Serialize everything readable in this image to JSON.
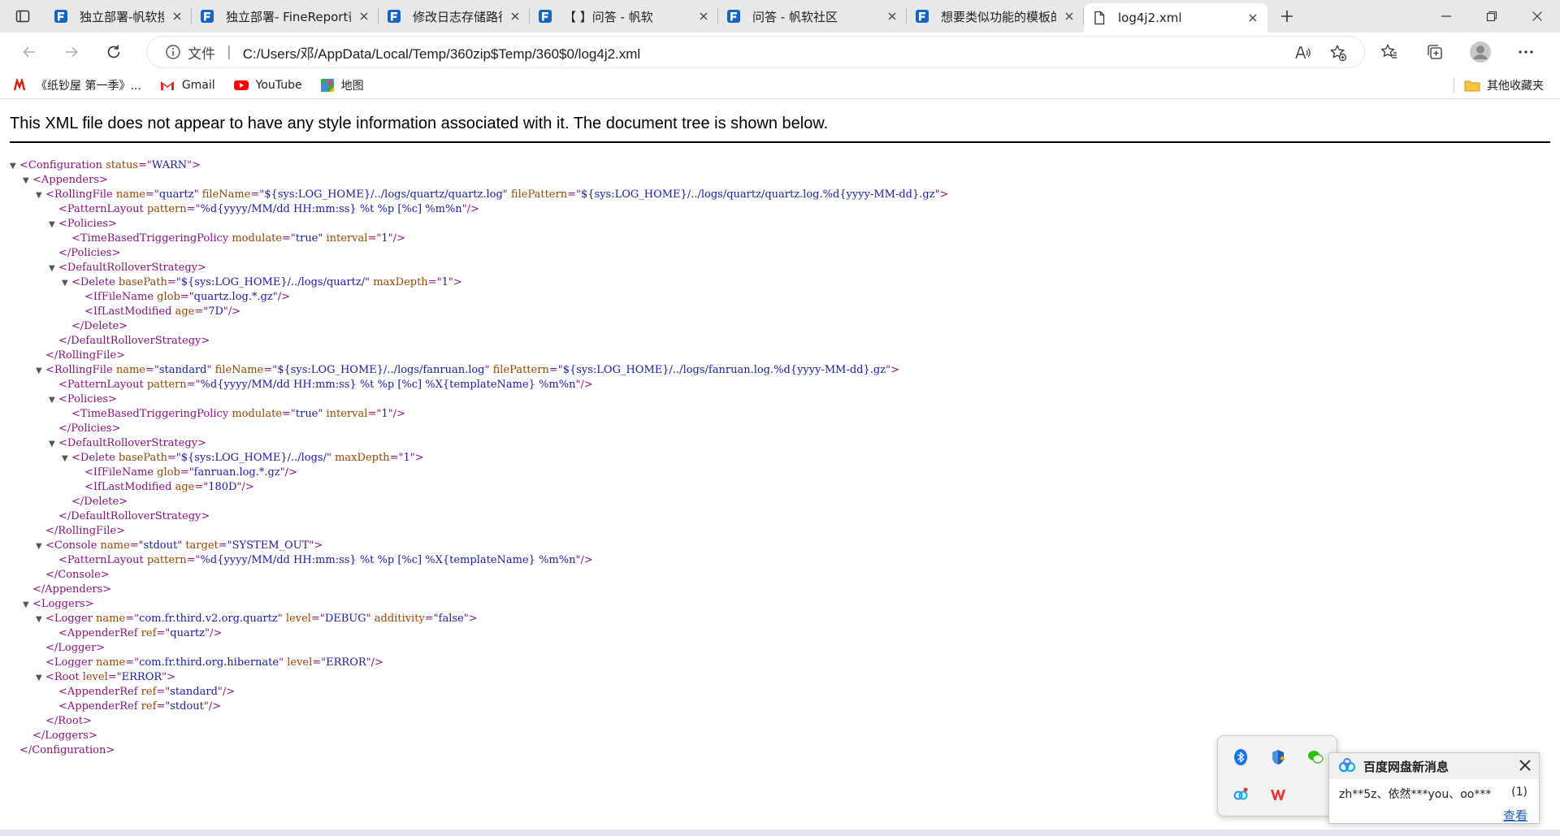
{
  "browser": {
    "tabs": [
      {
        "title": "独立部署-帆软搜索",
        "active": false
      },
      {
        "title": "独立部署- FineReport帮",
        "active": false
      },
      {
        "title": "修改日志存储路径-帆软",
        "active": false
      },
      {
        "title": "【                】问答 - 帆软",
        "active": false
      },
      {
        "title": "问答 - 帆软社区",
        "active": false
      },
      {
        "title": "想要类似功能的模板的",
        "active": false
      },
      {
        "title": "log4j2.xml",
        "active": true
      }
    ],
    "address": {
      "scheme_label": "文件",
      "separator": "|",
      "url": "C:/Users/邓/AppData/Local/Temp/360zip$Temp/360$0/log4j2.xml"
    },
    "bookmarks": [
      {
        "label": "《纸钞屋 第一季》...",
        "icon": "maoyan-icon"
      },
      {
        "label": "Gmail",
        "icon": "gmail-icon"
      },
      {
        "label": "YouTube",
        "icon": "youtube-icon"
      },
      {
        "label": "地图",
        "icon": "maps-icon"
      }
    ],
    "other_bookmarks": "其他收藏夹"
  },
  "xml_viewer": {
    "header": "This XML file does not appear to have any style information associated with it. The document tree is shown below.",
    "lines": [
      {
        "indent": 0,
        "toggle": true,
        "parts": [
          [
            "tg",
            "<Configuration "
          ],
          [
            "an",
            "status"
          ],
          [
            "tg",
            "=\""
          ],
          [
            "av",
            "WARN"
          ],
          [
            "tg",
            "\">"
          ]
        ]
      },
      {
        "indent": 1,
        "toggle": true,
        "parts": [
          [
            "tg",
            "<Appenders>"
          ]
        ]
      },
      {
        "indent": 2,
        "toggle": true,
        "parts": [
          [
            "tg",
            "<RollingFile "
          ],
          [
            "an",
            "name"
          ],
          [
            "tg",
            "=\""
          ],
          [
            "av",
            "quartz"
          ],
          [
            "tg",
            "\" "
          ],
          [
            "an",
            "fileName"
          ],
          [
            "tg",
            "=\""
          ],
          [
            "av",
            "${sys:LOG_HOME}/../logs/quartz/quartz.log"
          ],
          [
            "tg",
            "\" "
          ],
          [
            "an",
            "filePattern"
          ],
          [
            "tg",
            "=\""
          ],
          [
            "av",
            "${sys:LOG_HOME}/../logs/quartz/quartz.log.%d{yyyy-MM-dd}.gz"
          ],
          [
            "tg",
            "\">"
          ]
        ]
      },
      {
        "indent": 3,
        "toggle": false,
        "parts": [
          [
            "tg",
            "<PatternLayout "
          ],
          [
            "an",
            "pattern"
          ],
          [
            "tg",
            "=\""
          ],
          [
            "av",
            "%d{yyyy/MM/dd HH:mm:ss} %t %p [%c] %m%n"
          ],
          [
            "tg",
            "\"/>"
          ]
        ]
      },
      {
        "indent": 3,
        "toggle": true,
        "parts": [
          [
            "tg",
            "<Policies>"
          ]
        ]
      },
      {
        "indent": 4,
        "toggle": false,
        "parts": [
          [
            "tg",
            "<TimeBasedTriggeringPolicy "
          ],
          [
            "an",
            "modulate"
          ],
          [
            "tg",
            "=\""
          ],
          [
            "av",
            "true"
          ],
          [
            "tg",
            "\" "
          ],
          [
            "an",
            "interval"
          ],
          [
            "tg",
            "=\""
          ],
          [
            "av",
            "1"
          ],
          [
            "tg",
            "\"/>"
          ]
        ]
      },
      {
        "indent": 3,
        "toggle": false,
        "parts": [
          [
            "tg",
            "</Policies>"
          ]
        ]
      },
      {
        "indent": 3,
        "toggle": true,
        "parts": [
          [
            "tg",
            "<DefaultRolloverStrategy>"
          ]
        ]
      },
      {
        "indent": 4,
        "toggle": true,
        "parts": [
          [
            "tg",
            "<Delete "
          ],
          [
            "an",
            "basePath"
          ],
          [
            "tg",
            "=\""
          ],
          [
            "av",
            "${sys:LOG_HOME}/../logs/quartz/"
          ],
          [
            "tg",
            "\" "
          ],
          [
            "an",
            "maxDepth"
          ],
          [
            "tg",
            "=\""
          ],
          [
            "av",
            "1"
          ],
          [
            "tg",
            "\">"
          ]
        ]
      },
      {
        "indent": 5,
        "toggle": false,
        "parts": [
          [
            "tg",
            "<IfFileName "
          ],
          [
            "an",
            "glob"
          ],
          [
            "tg",
            "=\""
          ],
          [
            "av",
            "quartz.log.*.gz"
          ],
          [
            "tg",
            "\"/>"
          ]
        ]
      },
      {
        "indent": 5,
        "toggle": false,
        "parts": [
          [
            "tg",
            "<IfLastModified "
          ],
          [
            "an",
            "age"
          ],
          [
            "tg",
            "=\""
          ],
          [
            "av",
            "7D"
          ],
          [
            "tg",
            "\"/>"
          ]
        ]
      },
      {
        "indent": 4,
        "toggle": false,
        "parts": [
          [
            "tg",
            "</Delete>"
          ]
        ]
      },
      {
        "indent": 3,
        "toggle": false,
        "parts": [
          [
            "tg",
            "</DefaultRolloverStrategy>"
          ]
        ]
      },
      {
        "indent": 2,
        "toggle": false,
        "parts": [
          [
            "tg",
            "</RollingFile>"
          ]
        ]
      },
      {
        "indent": 2,
        "toggle": true,
        "parts": [
          [
            "tg",
            "<RollingFile "
          ],
          [
            "an",
            "name"
          ],
          [
            "tg",
            "=\""
          ],
          [
            "av",
            "standard"
          ],
          [
            "tg",
            "\" "
          ],
          [
            "an",
            "fileName"
          ],
          [
            "tg",
            "=\""
          ],
          [
            "av",
            "${sys:LOG_HOME}/../logs/fanruan.log"
          ],
          [
            "tg",
            "\" "
          ],
          [
            "an",
            "filePattern"
          ],
          [
            "tg",
            "=\""
          ],
          [
            "av",
            "${sys:LOG_HOME}/../logs/fanruan.log.%d{yyyy-MM-dd}.gz"
          ],
          [
            "tg",
            "\">"
          ]
        ]
      },
      {
        "indent": 3,
        "toggle": false,
        "parts": [
          [
            "tg",
            "<PatternLayout "
          ],
          [
            "an",
            "pattern"
          ],
          [
            "tg",
            "=\""
          ],
          [
            "av",
            "%d{yyyy/MM/dd HH:mm:ss} %t %p [%c] %X{templateName} %m%n"
          ],
          [
            "tg",
            "\"/>"
          ]
        ]
      },
      {
        "indent": 3,
        "toggle": true,
        "parts": [
          [
            "tg",
            "<Policies>"
          ]
        ]
      },
      {
        "indent": 4,
        "toggle": false,
        "parts": [
          [
            "tg",
            "<TimeBasedTriggeringPolicy "
          ],
          [
            "an",
            "modulate"
          ],
          [
            "tg",
            "=\""
          ],
          [
            "av",
            "true"
          ],
          [
            "tg",
            "\" "
          ],
          [
            "an",
            "interval"
          ],
          [
            "tg",
            "=\""
          ],
          [
            "av",
            "1"
          ],
          [
            "tg",
            "\"/>"
          ]
        ]
      },
      {
        "indent": 3,
        "toggle": false,
        "parts": [
          [
            "tg",
            "</Policies>"
          ]
        ]
      },
      {
        "indent": 3,
        "toggle": true,
        "parts": [
          [
            "tg",
            "<DefaultRolloverStrategy>"
          ]
        ]
      },
      {
        "indent": 4,
        "toggle": true,
        "parts": [
          [
            "tg",
            "<Delete "
          ],
          [
            "an",
            "basePath"
          ],
          [
            "tg",
            "=\""
          ],
          [
            "av",
            "${sys:LOG_HOME}/../logs/"
          ],
          [
            "tg",
            "\" "
          ],
          [
            "an",
            "maxDepth"
          ],
          [
            "tg",
            "=\""
          ],
          [
            "av",
            "1"
          ],
          [
            "tg",
            "\">"
          ]
        ]
      },
      {
        "indent": 5,
        "toggle": false,
        "parts": [
          [
            "tg",
            "<IfFileName "
          ],
          [
            "an",
            "glob"
          ],
          [
            "tg",
            "=\""
          ],
          [
            "av",
            "fanruan.log.*.gz"
          ],
          [
            "tg",
            "\"/>"
          ]
        ]
      },
      {
        "indent": 5,
        "toggle": false,
        "parts": [
          [
            "tg",
            "<IfLastModified "
          ],
          [
            "an",
            "age"
          ],
          [
            "tg",
            "=\""
          ],
          [
            "av",
            "180D"
          ],
          [
            "tg",
            "\"/>"
          ]
        ]
      },
      {
        "indent": 4,
        "toggle": false,
        "parts": [
          [
            "tg",
            "</Delete>"
          ]
        ]
      },
      {
        "indent": 3,
        "toggle": false,
        "parts": [
          [
            "tg",
            "</DefaultRolloverStrategy>"
          ]
        ]
      },
      {
        "indent": 2,
        "toggle": false,
        "parts": [
          [
            "tg",
            "</RollingFile>"
          ]
        ]
      },
      {
        "indent": 2,
        "toggle": true,
        "parts": [
          [
            "tg",
            "<Console "
          ],
          [
            "an",
            "name"
          ],
          [
            "tg",
            "=\""
          ],
          [
            "av",
            "stdout"
          ],
          [
            "tg",
            "\" "
          ],
          [
            "an",
            "target"
          ],
          [
            "tg",
            "=\""
          ],
          [
            "av",
            "SYSTEM_OUT"
          ],
          [
            "tg",
            "\">"
          ]
        ]
      },
      {
        "indent": 3,
        "toggle": false,
        "parts": [
          [
            "tg",
            "<PatternLayout "
          ],
          [
            "an",
            "pattern"
          ],
          [
            "tg",
            "=\""
          ],
          [
            "av",
            "%d{yyyy/MM/dd HH:mm:ss} %t %p [%c] %X{templateName} %m%n"
          ],
          [
            "tg",
            "\"/>"
          ]
        ]
      },
      {
        "indent": 2,
        "toggle": false,
        "parts": [
          [
            "tg",
            "</Console>"
          ]
        ]
      },
      {
        "indent": 1,
        "toggle": false,
        "parts": [
          [
            "tg",
            "</Appenders>"
          ]
        ]
      },
      {
        "indent": 1,
        "toggle": true,
        "parts": [
          [
            "tg",
            "<Loggers>"
          ]
        ]
      },
      {
        "indent": 2,
        "toggle": true,
        "parts": [
          [
            "tg",
            "<Logger "
          ],
          [
            "an",
            "name"
          ],
          [
            "tg",
            "=\""
          ],
          [
            "av",
            "com.fr.third.v2.org.quartz"
          ],
          [
            "tg",
            "\" "
          ],
          [
            "an",
            "level"
          ],
          [
            "tg",
            "=\""
          ],
          [
            "av",
            "DEBUG"
          ],
          [
            "tg",
            "\" "
          ],
          [
            "an",
            "additivity"
          ],
          [
            "tg",
            "=\""
          ],
          [
            "av",
            "false"
          ],
          [
            "tg",
            "\">"
          ]
        ]
      },
      {
        "indent": 3,
        "toggle": false,
        "parts": [
          [
            "tg",
            "<AppenderRef "
          ],
          [
            "an",
            "ref"
          ],
          [
            "tg",
            "=\""
          ],
          [
            "av",
            "quartz"
          ],
          [
            "tg",
            "\"/>"
          ]
        ]
      },
      {
        "indent": 2,
        "toggle": false,
        "parts": [
          [
            "tg",
            "</Logger>"
          ]
        ]
      },
      {
        "indent": 2,
        "toggle": false,
        "parts": [
          [
            "tg",
            "<Logger "
          ],
          [
            "an",
            "name"
          ],
          [
            "tg",
            "=\""
          ],
          [
            "av",
            "com.fr.third.org.hibernate"
          ],
          [
            "tg",
            "\" "
          ],
          [
            "an",
            "level"
          ],
          [
            "tg",
            "=\""
          ],
          [
            "av",
            "ERROR"
          ],
          [
            "tg",
            "\"/>"
          ]
        ]
      },
      {
        "indent": 2,
        "toggle": true,
        "parts": [
          [
            "tg",
            "<Root "
          ],
          [
            "an",
            "level"
          ],
          [
            "tg",
            "=\""
          ],
          [
            "av",
            "ERROR"
          ],
          [
            "tg",
            "\">"
          ]
        ]
      },
      {
        "indent": 3,
        "toggle": false,
        "parts": [
          [
            "tg",
            "<AppenderRef "
          ],
          [
            "an",
            "ref"
          ],
          [
            "tg",
            "=\""
          ],
          [
            "av",
            "standard"
          ],
          [
            "tg",
            "\"/>"
          ]
        ]
      },
      {
        "indent": 3,
        "toggle": false,
        "parts": [
          [
            "tg",
            "<AppenderRef "
          ],
          [
            "an",
            "ref"
          ],
          [
            "tg",
            "=\""
          ],
          [
            "av",
            "stdout"
          ],
          [
            "tg",
            "\"/>"
          ]
        ]
      },
      {
        "indent": 2,
        "toggle": false,
        "parts": [
          [
            "tg",
            "</Root>"
          ]
        ]
      },
      {
        "indent": 1,
        "toggle": false,
        "parts": [
          [
            "tg",
            "</Loggers>"
          ]
        ]
      },
      {
        "indent": 0,
        "toggle": false,
        "parts": [
          [
            "tg",
            "</Configuration>"
          ]
        ]
      }
    ]
  },
  "tray_popup": {
    "icons": [
      "bluetooth-icon",
      "security-shield-icon",
      "wechat-icon",
      "baidu-netdisk-icon",
      "wps-icon"
    ]
  },
  "notification": {
    "title": "百度网盘新消息",
    "message": "zh**5z、依然***you、oo***",
    "count": "(1)",
    "link": "查看"
  },
  "colors": {
    "tag": "#881280",
    "attr_name": "#994500",
    "attr_value": "#1a1aa6",
    "fanruan_blue": "#1565c0"
  }
}
